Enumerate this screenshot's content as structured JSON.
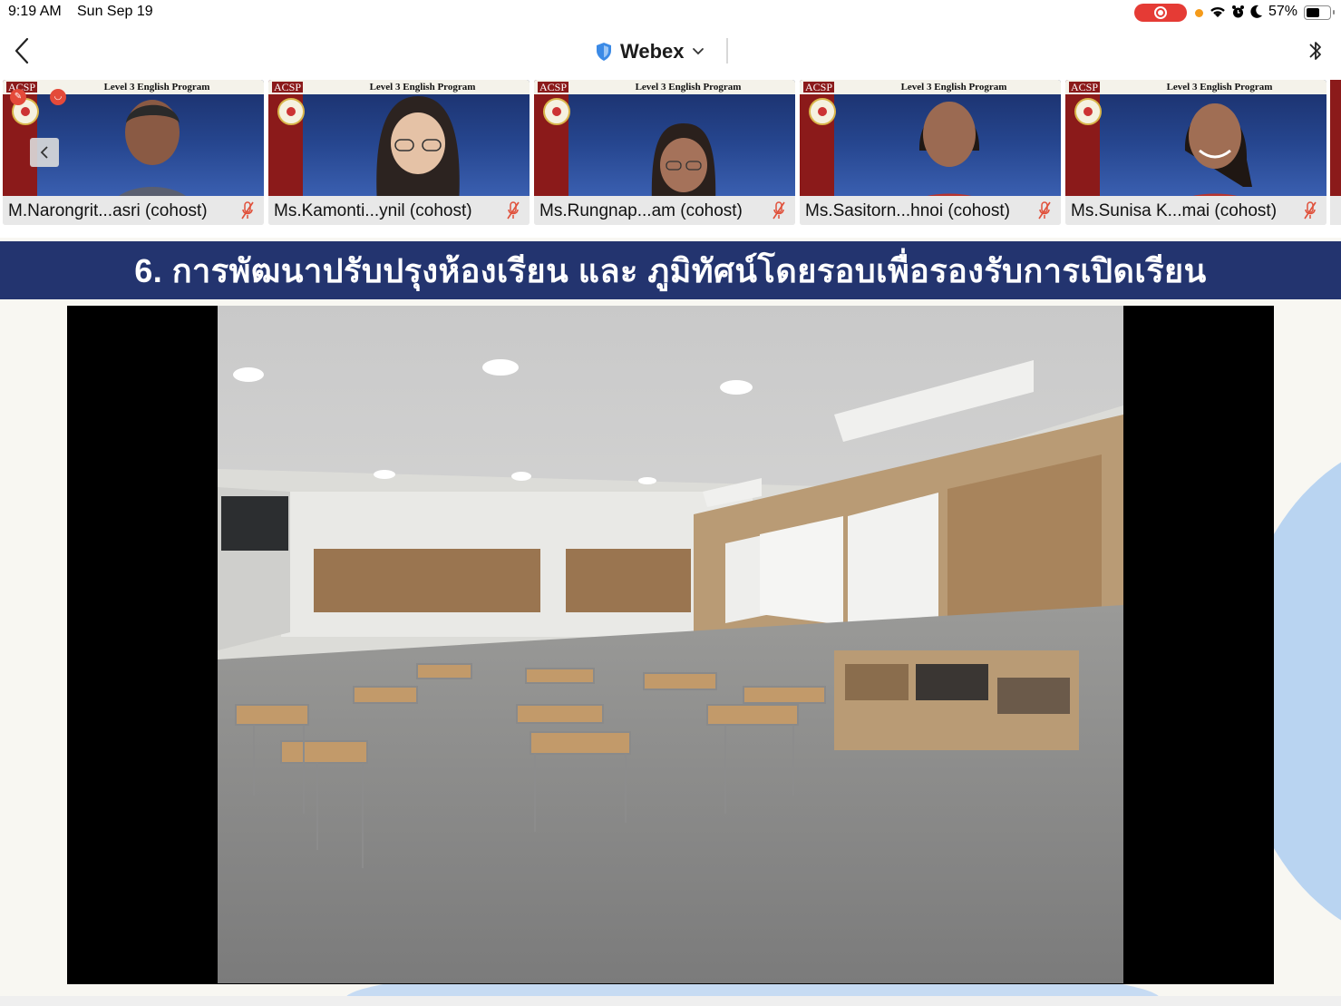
{
  "status_bar": {
    "time": "9:19 AM",
    "date": "Sun Sep 19",
    "battery_percent": "57%",
    "icons": [
      "record-indicator",
      "wifi-icon",
      "alarm-icon",
      "moon-icon",
      "battery-icon"
    ],
    "colors": {
      "recording": "#e53b35",
      "mic_dot": "#f59b1a"
    }
  },
  "nav": {
    "title": "Webex",
    "icons": [
      "back-chevron-icon",
      "shield-icon",
      "chevron-down-icon",
      "bluetooth-icon"
    ]
  },
  "participants": [
    {
      "name": "M.Narongrit...asri (cohost)",
      "banner": "Level 3 English Program",
      "badge": "ACSP"
    },
    {
      "name": "Ms.Kamonti...ynil (cohost)",
      "banner": "Level 3 English Program",
      "badge": "ACSP"
    },
    {
      "name": "Ms.Rungnap...am (cohost)",
      "banner": "Level 3 English Program",
      "badge": "ACSP"
    },
    {
      "name": "Ms.Sasitorn...hnoi (cohost)",
      "banner": "Level 3 English Program",
      "badge": "ACSP"
    },
    {
      "name": "Ms.Sunisa K...mai (cohost)",
      "banner": "Level 3 English Program",
      "badge": "ACSP"
    }
  ],
  "slide": {
    "title": "6. การพัฒนาปรับปรุงห้องเรียน และ ภูมิทัศน์โดยรอบเพื่อรองรับการเปิดเรียน",
    "colors": {
      "header": "#23346f",
      "accent": "#b9d4f1"
    }
  }
}
